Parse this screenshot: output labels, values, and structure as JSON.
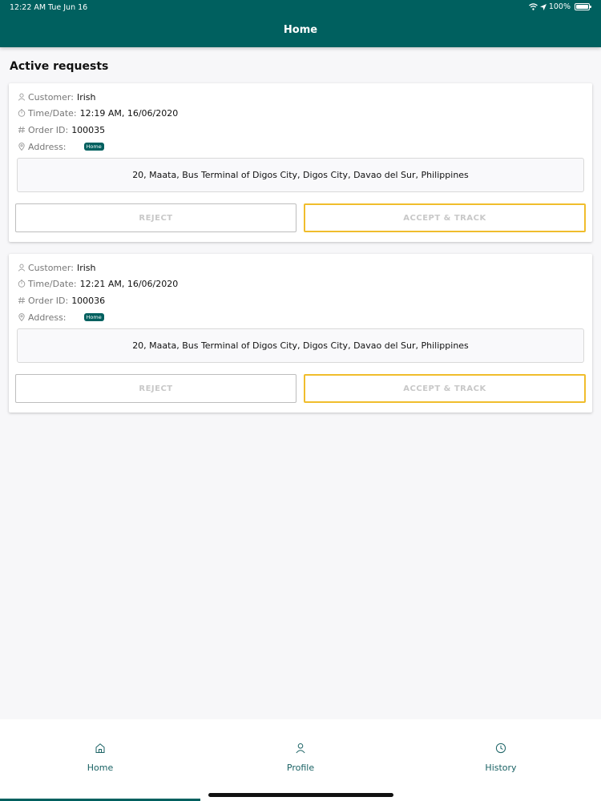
{
  "status_bar": {
    "time": "12:22 AM",
    "date": "Tue Jun 16",
    "battery": "100%"
  },
  "header": {
    "title": "Home"
  },
  "section": {
    "title": "Active requests"
  },
  "requests": [
    {
      "customer_label": "Customer:",
      "customer": "Irish",
      "time_label": "Time/Date:",
      "time": "12:19 AM, 16/06/2020",
      "order_label": "Order ID:",
      "order_id": "100035",
      "address_label": "Address:",
      "address_tag": "Home",
      "address": "20, Maata, Bus Terminal of Digos City, Digos City, Davao del Sur, Philippines",
      "reject_label": "REJECT",
      "accept_label": "ACCEPT & TRACK"
    },
    {
      "customer_label": "Customer:",
      "customer": "Irish",
      "time_label": "Time/Date:",
      "time": "12:21 AM, 16/06/2020",
      "order_label": "Order ID:",
      "order_id": "100036",
      "address_label": "Address:",
      "address_tag": "Home",
      "address": "20, Maata, Bus Terminal of Digos City, Digos City, Davao del Sur, Philippines",
      "reject_label": "REJECT",
      "accept_label": "ACCEPT & TRACK"
    }
  ],
  "nav": {
    "items": [
      {
        "label": "Home",
        "icon": "home-icon"
      },
      {
        "label": "Profile",
        "icon": "user-icon"
      },
      {
        "label": "History",
        "icon": "clock-icon"
      }
    ],
    "active": "Home"
  },
  "colors": {
    "primary": "#00605f",
    "accept_border": "#f0bd2c",
    "background": "#f7f7f9"
  }
}
